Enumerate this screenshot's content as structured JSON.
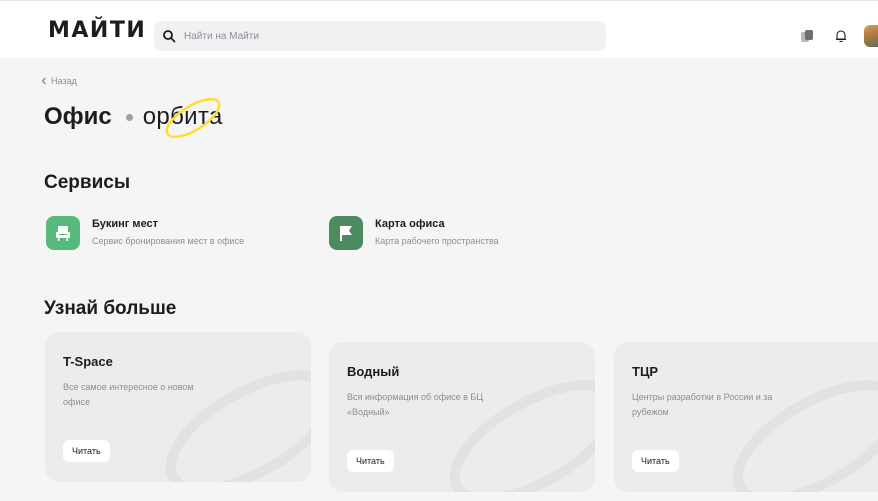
{
  "header": {
    "logo": "МАЙТИ",
    "search_placeholder": "Найти на Майти"
  },
  "page": {
    "back_label": "Назад",
    "title": "Офис",
    "brand": "орбита"
  },
  "services": {
    "heading": "Сервисы",
    "items": [
      {
        "name": "Букинг мест",
        "desc": "Сервис бронирования мест в офисе",
        "color": "#57b97c",
        "icon": "chair-icon"
      },
      {
        "name": "Карта офиса",
        "desc": "Карта рабочего пространства",
        "color": "#4e8a5f",
        "icon": "flag-icon"
      }
    ]
  },
  "learn": {
    "heading": "Узнай больше",
    "cards": [
      {
        "title": "T-Space",
        "desc": "Все самое интересное о новом офисе",
        "button": "Читать"
      },
      {
        "title": "Водный",
        "desc": "Вся информация об офисе в БЦ «Водный»",
        "button": "Читать"
      },
      {
        "title": "ТЦР",
        "desc": "Центры разработки в России и за рубежом",
        "button": "Читать"
      }
    ]
  },
  "colors": {
    "accent_yellow": "#ffdd2d",
    "text": "#1d1d1f",
    "muted": "#8e8e93"
  }
}
